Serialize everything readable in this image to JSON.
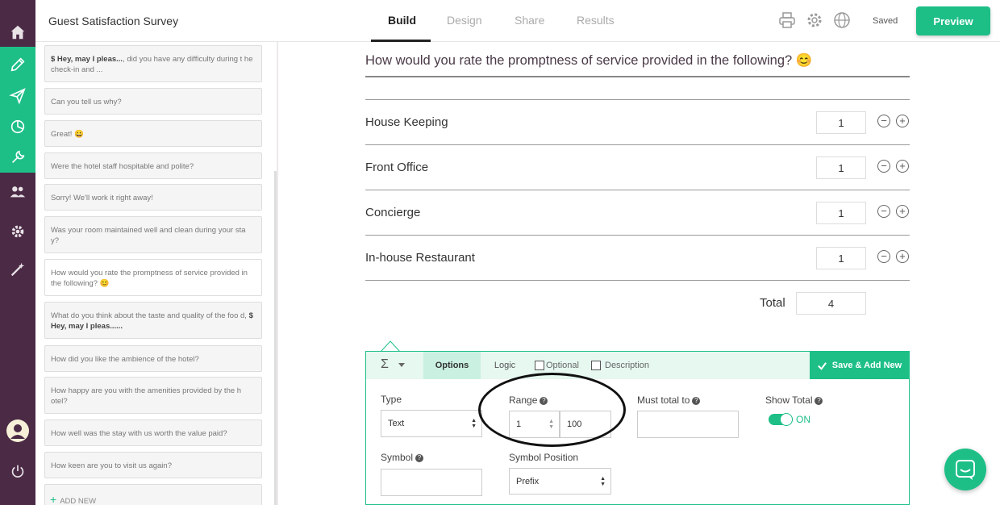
{
  "app": {
    "survey_title": "Guest Satisfaction Survey",
    "saved_status": "Saved",
    "preview_label": "Preview"
  },
  "tabs": [
    {
      "label": "Build",
      "active": true
    },
    {
      "label": "Design",
      "active": false
    },
    {
      "label": "Share",
      "active": false
    },
    {
      "label": "Results",
      "active": false
    }
  ],
  "rail_icons": [
    "home-icon",
    "pencil-icon",
    "send-icon",
    "chart-icon",
    "wrench-icon",
    "people-icon",
    "gear-icon",
    "magic-wand-icon",
    "user-avatar-icon",
    "power-icon"
  ],
  "sidebar": {
    "questions": [
      {
        "bold": "$ Hey, may I pleas...",
        "text": ", did you have any difficulty during t he check-in and ..."
      },
      {
        "text": "Can you tell us why?"
      },
      {
        "text": "Great! 😀"
      },
      {
        "text": "Were the hotel staff hospitable and polite?"
      },
      {
        "text": "Sorry! We'll work it right away!"
      },
      {
        "text": "Was your room maintained well and clean during your sta y?"
      },
      {
        "text": "How would you rate the promptness of service provided in the following? 😊"
      },
      {
        "text": "What do you think about the taste and quality of the foo d, ",
        "bold_tail": "$ Hey, may I pleas......"
      },
      {
        "text": "How did you like the ambience of the hotel?"
      },
      {
        "text": "How happy are you with the amenities provided by the h otel?"
      },
      {
        "text": "How well was the stay with us worth the value paid?"
      },
      {
        "text": "How keen are you to visit us again?"
      }
    ],
    "add_new": "ADD NEW"
  },
  "question": {
    "text": "How would you rate the promptness of service provided in the following? 😊",
    "rows": [
      {
        "label": "House Keeping",
        "value": "1"
      },
      {
        "label": "Front Office",
        "value": "1"
      },
      {
        "label": "Concierge",
        "value": "1"
      },
      {
        "label": "In-house Restaurant",
        "value": "1"
      }
    ],
    "total_label": "Total",
    "total_value": "4"
  },
  "panel": {
    "sigma": "Σ",
    "tabs": {
      "options": "Options",
      "logic": "Logic"
    },
    "optional_label": "Optional",
    "description_label": "Description",
    "save_add_label": "Save & Add New",
    "type_label": "Type",
    "type_value": "Text",
    "range_label": "Range",
    "range_min": "1",
    "range_max": "100",
    "must_total_label": "Must total to",
    "must_total_value": "",
    "show_total_label": "Show Total",
    "show_total_state": "ON",
    "symbol_label": "Symbol",
    "symbol_value": "",
    "symbol_position_label": "Symbol Position",
    "symbol_position_value": "Prefix"
  },
  "colors": {
    "accent": "#1dbf87",
    "rail": "#4b2a45"
  }
}
